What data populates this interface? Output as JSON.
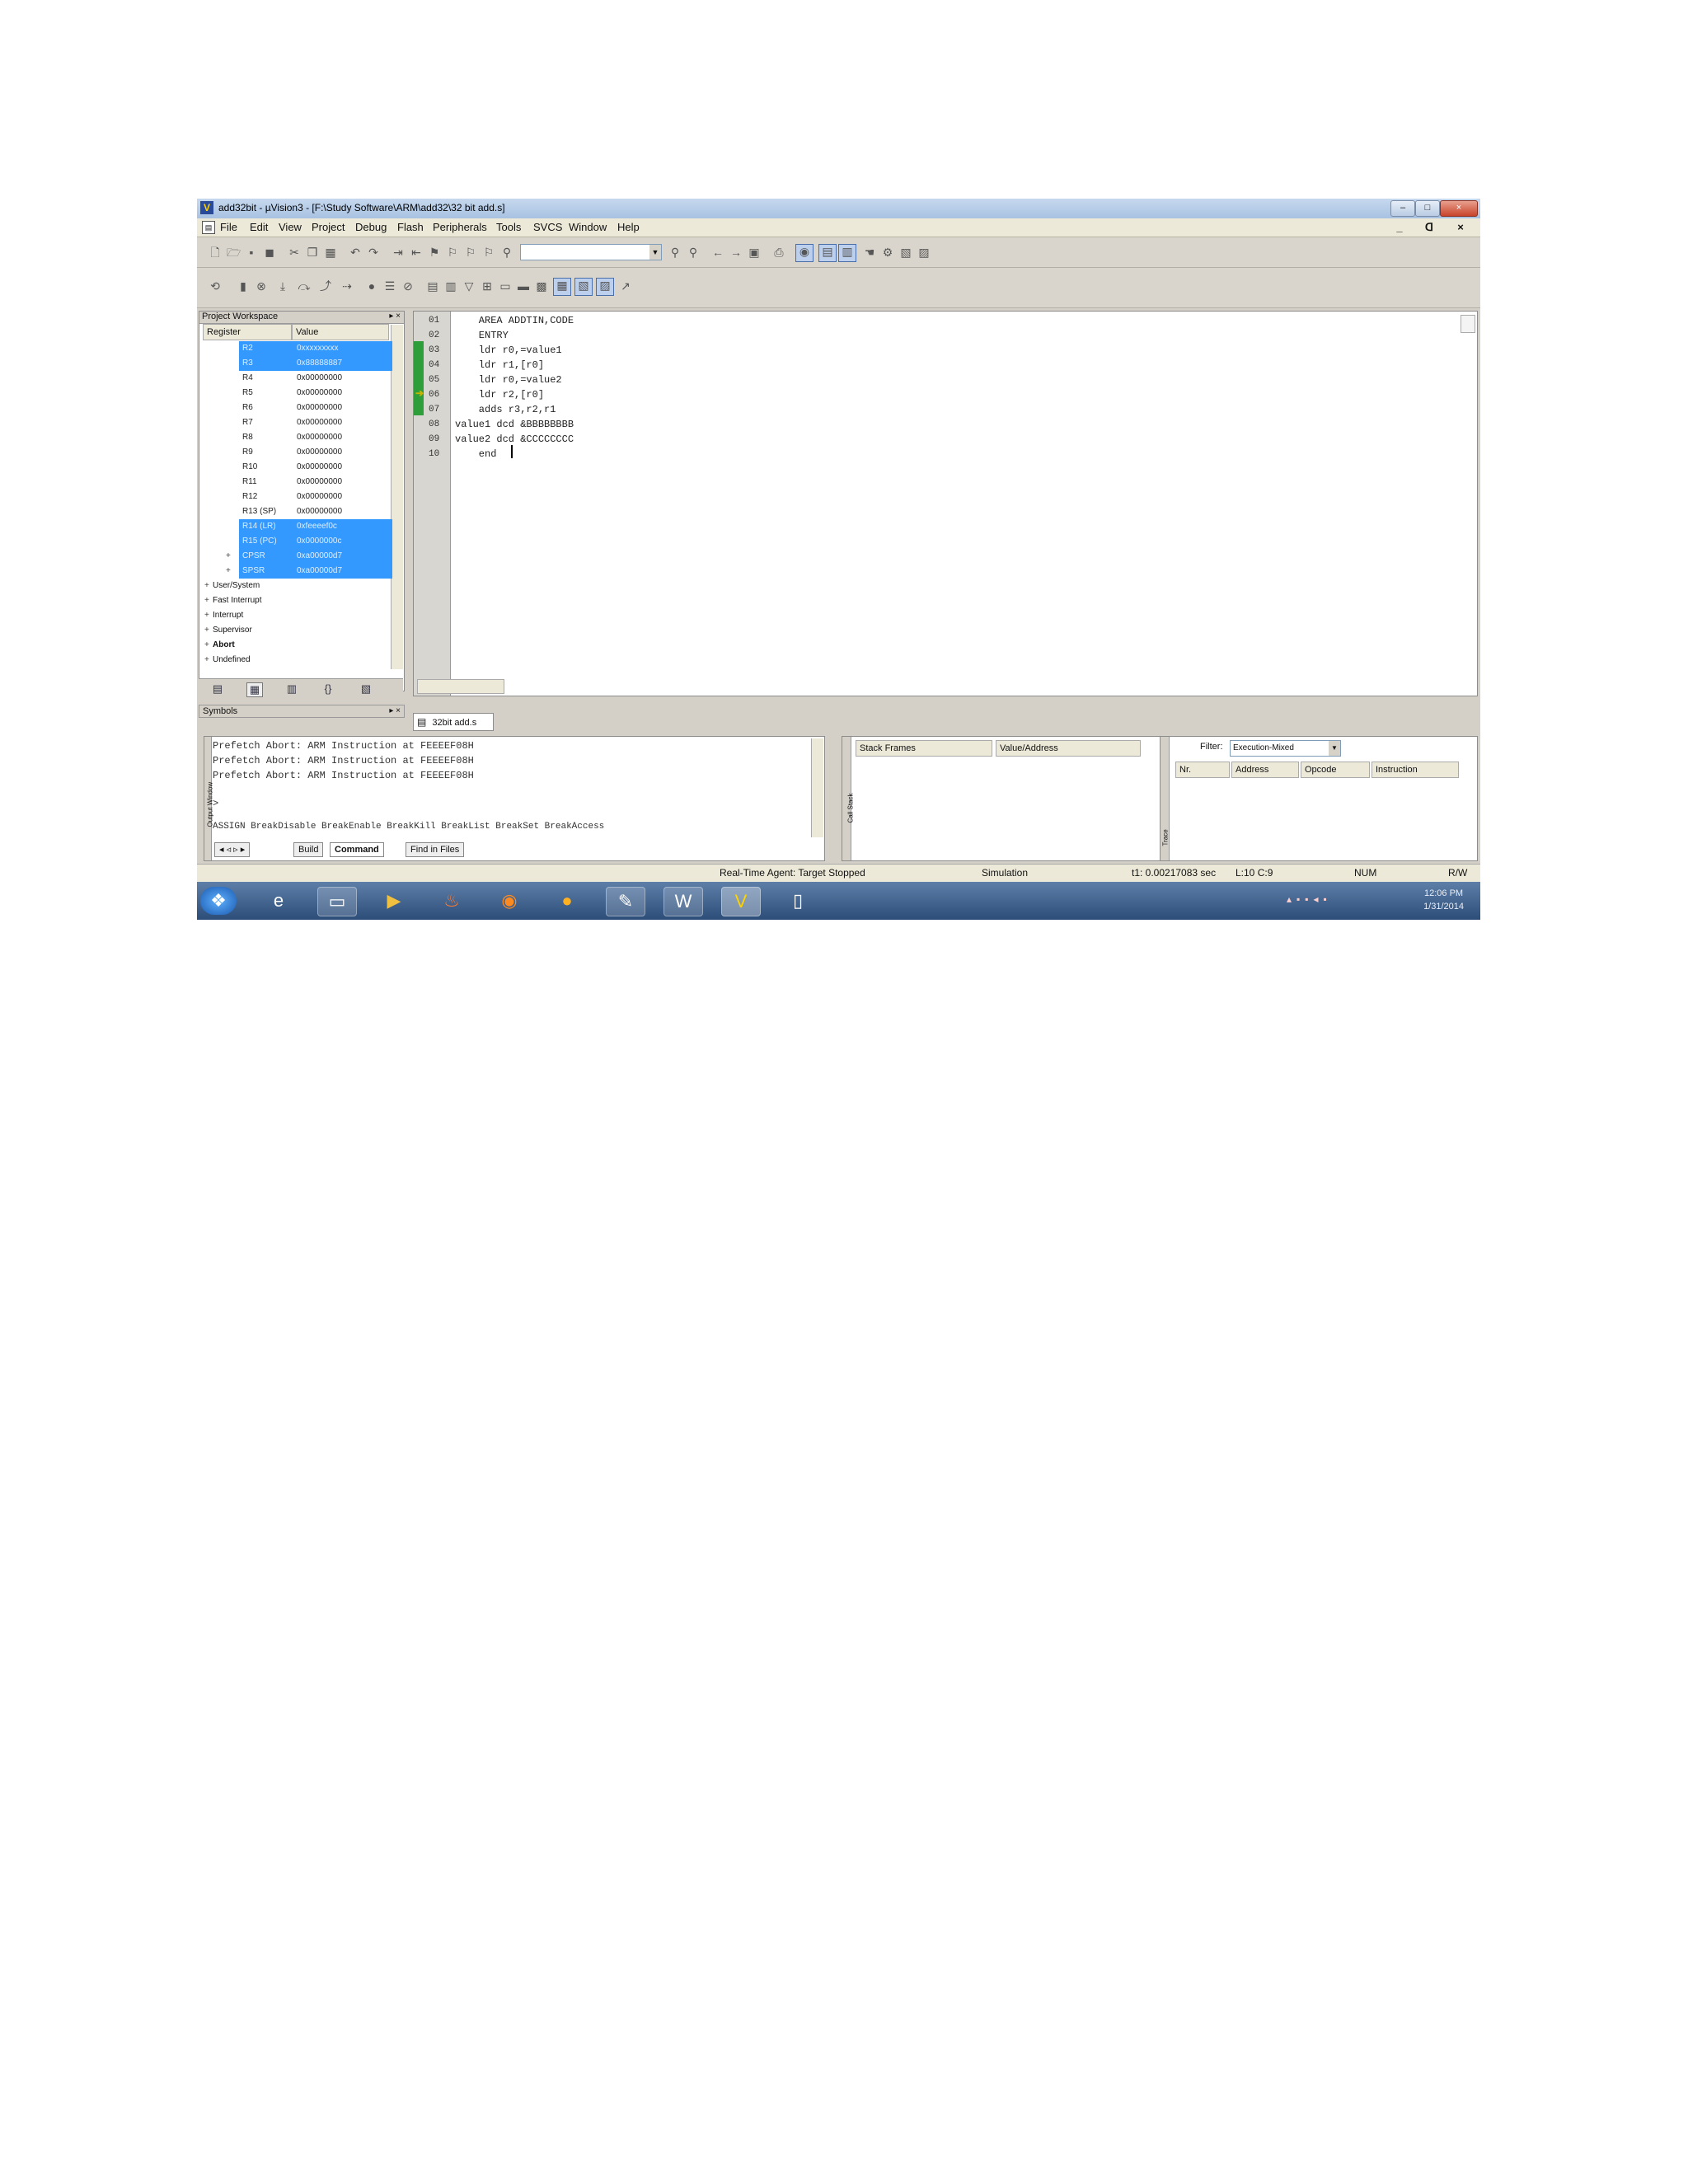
{
  "window": {
    "title": "add32bit - µVision3 - [F:\\Study Software\\ARM\\add32\\32 bit add.s]",
    "buttons": [
      "–",
      "□",
      "×"
    ]
  },
  "menu": {
    "items": [
      "File",
      "Edit",
      "View",
      "Project",
      "Debug",
      "Flash",
      "Peripherals",
      "Tools",
      "SVCS",
      "Window",
      "Help"
    ],
    "mdi_buttons": [
      "_",
      "ᗡ",
      "×"
    ]
  },
  "left_panel": {
    "title": "Project Workspace",
    "columns": [
      "Register",
      "Value"
    ],
    "registers": [
      {
        "name": "R2",
        "value": "0xxxxxxxxx",
        "selected": true
      },
      {
        "name": "R3",
        "value": "0x88888887",
        "selected": true
      },
      {
        "name": "R4",
        "value": "0x00000000",
        "selected": false
      },
      {
        "name": "R5",
        "value": "0x00000000",
        "selected": false
      },
      {
        "name": "R6",
        "value": "0x00000000",
        "selected": false
      },
      {
        "name": "R7",
        "value": "0x00000000",
        "selected": false
      },
      {
        "name": "R8",
        "value": "0x00000000",
        "selected": false
      },
      {
        "name": "R9",
        "value": "0x00000000",
        "selected": false
      },
      {
        "name": "R10",
        "value": "0x00000000",
        "selected": false
      },
      {
        "name": "R11",
        "value": "0x00000000",
        "selected": false
      },
      {
        "name": "R12",
        "value": "0x00000000",
        "selected": false
      },
      {
        "name": "R13 (SP)",
        "value": "0x00000000",
        "selected": false
      },
      {
        "name": "R14 (LR)",
        "value": "0xfeeeef0c",
        "selected": true
      },
      {
        "name": "R15 (PC)",
        "value": "0x0000000c",
        "selected": true
      },
      {
        "name": "CPSR",
        "value": "0xa00000d7",
        "selected": true
      },
      {
        "name": "SPSR",
        "value": "0xa00000d7",
        "selected": true
      }
    ],
    "modes": [
      "User/System",
      "Fast Interrupt",
      "Interrupt",
      "Supervisor",
      "Abort",
      "Undefined"
    ],
    "symbols_label": "Symbols"
  },
  "editor": {
    "tab_label": "32bit add.s",
    "lines": [
      {
        "num": "01",
        "code": "    AREA ADDTIN,CODE"
      },
      {
        "num": "02",
        "code": "    ENTRY"
      },
      {
        "num": "03",
        "code": "    ldr r0,=value1"
      },
      {
        "num": "04",
        "code": "    ldr r1,[r0]"
      },
      {
        "num": "05",
        "code": "    ldr r0,=value2"
      },
      {
        "num": "06",
        "code": "    ldr r2,[r0]"
      },
      {
        "num": "07",
        "code": "    adds r3,r2,r1"
      },
      {
        "num": "08",
        "code": "value1 dcd &BBBBBBBB"
      },
      {
        "num": "09",
        "code": "value2 dcd &CCCCCCCC"
      },
      {
        "num": "10",
        "code": "    end"
      }
    ]
  },
  "output": {
    "lines": [
      "Prefetch Abort: ARM Instruction at FEEEEF08H",
      "Prefetch Abort: ARM Instruction at FEEEEF08H",
      "Prefetch Abort: ARM Instruction at FEEEEF08H"
    ],
    "prompt": ">",
    "command_hint": "ASSIGN BreakDisable BreakEnable BreakKill BreakList BreakSet BreakAccess",
    "tabs": [
      "Build",
      "Command",
      "Find in Files"
    ],
    "side_label": "Output Window"
  },
  "callstack": {
    "columns": [
      "Stack Frames",
      "Value/Address"
    ],
    "side_label": "Call Stack"
  },
  "trace": {
    "filter_label": "Filter:",
    "filter_value": "Execution-Mixed",
    "columns": [
      "Nr.",
      "Address",
      "Opcode",
      "Instruction"
    ],
    "side_label": "Trace"
  },
  "statusbar": {
    "agent": "Real-Time Agent: Target Stopped",
    "mode": "Simulation",
    "time": "t1: 0.00217083 sec",
    "position": "L:10 C:9",
    "num": "NUM",
    "rw": "R/W"
  },
  "taskbar": {
    "clock_time": "12:06 PM",
    "clock_date": "1/31/2014"
  }
}
